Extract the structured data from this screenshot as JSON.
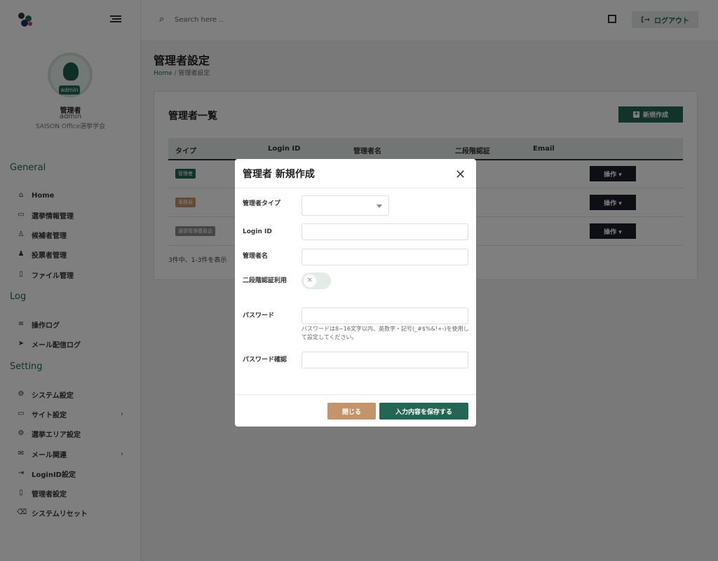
{
  "topbar": {
    "search_placeholder": "Search here ..",
    "logout_label": "ログアウト"
  },
  "user": {
    "badge": "admin",
    "name": "管理者",
    "id": "admin",
    "org": "SAISON Office選挙学会"
  },
  "sidebar": {
    "sections": [
      {
        "title": "General"
      },
      {
        "title": "Log"
      },
      {
        "title": "Setting"
      }
    ],
    "items": [
      {
        "label": "Home",
        "icon": "home-icon"
      },
      {
        "label": "選挙情報管理",
        "icon": "archive-icon"
      },
      {
        "label": "候補者管理",
        "icon": "user-check-icon"
      },
      {
        "label": "投票者管理",
        "icon": "users-icon"
      },
      {
        "label": "ファイル管理",
        "icon": "file-icon"
      },
      {
        "label": "操作ログ",
        "icon": "database-icon"
      },
      {
        "label": "メール配信ログ",
        "icon": "send-icon"
      },
      {
        "label": "システム設定",
        "icon": "gear-icon"
      },
      {
        "label": "サイト設定",
        "icon": "monitor-icon"
      },
      {
        "label": "選挙エリア設定",
        "icon": "gear-icon"
      },
      {
        "label": "メール関連",
        "icon": "mail-icon"
      },
      {
        "label": "LoginID設定",
        "icon": "login-icon"
      },
      {
        "label": "管理者設定",
        "icon": "clipboard-icon"
      },
      {
        "label": "システムリセット",
        "icon": "delete-icon"
      }
    ]
  },
  "page": {
    "title": "管理者設定",
    "breadcrumb_home": "Home",
    "breadcrumb_sep": "/",
    "breadcrumb_current": "管理者設定"
  },
  "card": {
    "title": "管理者一覧",
    "new_button": "新規作成",
    "columns": [
      "タイプ",
      "Login ID",
      "管理者名",
      "二段階認証",
      "Email"
    ],
    "rows": [
      {
        "tag": "管理者",
        "tag_color": "#236653",
        "action": "操作"
      },
      {
        "tag": "事務局",
        "tag_color": "#c4956a",
        "action": "操作"
      },
      {
        "tag": "選挙管理委員会",
        "tag_color": "#8a8a8a",
        "action": "操作"
      }
    ],
    "count_text": "3件中、1-3件を表示"
  },
  "modal": {
    "title": "管理者 新規作成",
    "fields": {
      "type_label": "管理者タイプ",
      "login_label": "Login ID",
      "name_label": "管理者名",
      "twofa_label": "二段階認証利用",
      "password_label": "パスワード",
      "password_hint": "パスワードは8~16文字以内、英数字・記号(_#$%&!+-)を使用して設定してください。",
      "password_confirm_label": "パスワード確認"
    },
    "close_button": "閉じる",
    "save_button": "入力内容を保存する"
  },
  "colors": {
    "brand": "#236653",
    "accent_tan": "#c4956a",
    "dark": "#1a1f2b"
  }
}
